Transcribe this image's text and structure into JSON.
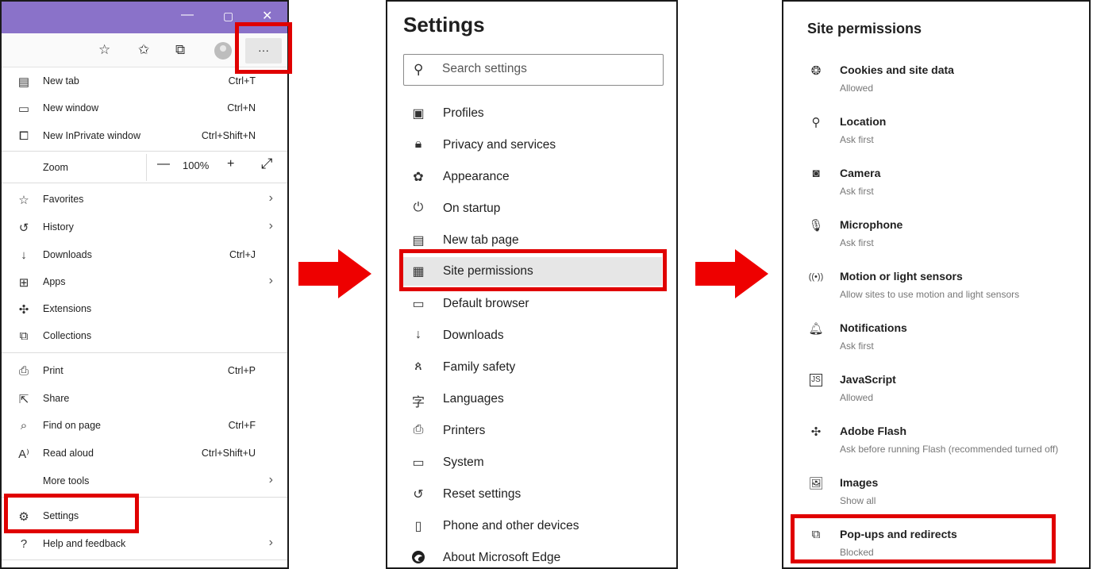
{
  "window": {
    "minimize": "—",
    "maximize": "▢",
    "close": "✕"
  },
  "toolbar": {
    "more_label": "···"
  },
  "menu": {
    "items_top": [
      {
        "label": "New tab",
        "shortcut": "Ctrl+T",
        "icon": "new-tab-icon"
      },
      {
        "label": "New window",
        "shortcut": "Ctrl+N",
        "icon": "window-icon"
      },
      {
        "label": "New InPrivate window",
        "shortcut": "Ctrl+Shift+N",
        "icon": "inprivate-icon"
      }
    ],
    "zoom": {
      "label": "Zoom",
      "minus": "—",
      "value": "100%",
      "plus": "+",
      "expand": "⤢"
    },
    "items_mid": [
      {
        "label": "Favorites",
        "icon": "favorites-icon"
      },
      {
        "label": "History",
        "icon": "history-icon"
      },
      {
        "label": "Downloads",
        "shortcut": "Ctrl+J",
        "icon": "download-icon"
      },
      {
        "label": "Apps",
        "icon": "apps-icon"
      },
      {
        "label": "Extensions",
        "icon": "extensions-icon"
      },
      {
        "label": "Collections",
        "icon": "collections-icon"
      }
    ],
    "items_bottom": [
      {
        "label": "Print",
        "shortcut": "Ctrl+P",
        "icon": "print-icon"
      },
      {
        "label": "Share",
        "icon": "share-icon"
      },
      {
        "label": "Find on page",
        "shortcut": "Ctrl+F",
        "icon": "find-icon"
      },
      {
        "label": "Read aloud",
        "shortcut": "Ctrl+Shift+U",
        "icon": "read-aloud-icon"
      },
      {
        "label": "More tools"
      },
      {
        "label": "Settings",
        "icon": "gear-icon"
      },
      {
        "label": "Help and feedback",
        "icon": "help-icon"
      }
    ]
  },
  "settings": {
    "title": "Settings",
    "search_placeholder": "Search settings",
    "items": [
      {
        "label": "Profiles",
        "icon": "profile-icon"
      },
      {
        "label": "Privacy and services",
        "icon": "lock-icon"
      },
      {
        "label": "Appearance",
        "icon": "palette-icon"
      },
      {
        "label": "On startup",
        "icon": "power-icon"
      },
      {
        "label": "New tab page",
        "icon": "new-tab-icon"
      },
      {
        "label": "Site permissions",
        "icon": "site-permissions-icon"
      },
      {
        "label": "Default browser",
        "icon": "browser-icon"
      },
      {
        "label": "Downloads",
        "icon": "download-icon"
      },
      {
        "label": "Family safety",
        "icon": "family-icon"
      },
      {
        "label": "Languages",
        "icon": "language-icon"
      },
      {
        "label": "Printers",
        "icon": "printer-icon"
      },
      {
        "label": "System",
        "icon": "system-icon"
      },
      {
        "label": "Reset settings",
        "icon": "reset-icon"
      },
      {
        "label": "Phone and other devices",
        "icon": "phone-icon"
      },
      {
        "label": "About Microsoft Edge",
        "icon": "edge-logo-icon"
      }
    ]
  },
  "permissions": {
    "title": "Site permissions",
    "items": [
      {
        "name": "Cookies and site data",
        "status": "Allowed",
        "icon": "cookie-icon"
      },
      {
        "name": "Location",
        "status": "Ask first",
        "icon": "location-icon"
      },
      {
        "name": "Camera",
        "status": "Ask first",
        "icon": "camera-icon"
      },
      {
        "name": "Microphone",
        "status": "Ask first",
        "icon": "microphone-icon"
      },
      {
        "name": "Motion or light sensors",
        "status": "Allow sites to use motion and light sensors",
        "icon": "sensor-icon"
      },
      {
        "name": "Notifications",
        "status": "Ask first",
        "icon": "bell-icon"
      },
      {
        "name": "JavaScript",
        "status": "Allowed",
        "icon": "javascript-icon"
      },
      {
        "name": "Adobe Flash",
        "status": "Ask before running Flash (recommended turned off)",
        "icon": "puzzle-icon"
      },
      {
        "name": "Images",
        "status": "Show all",
        "icon": "image-icon"
      },
      {
        "name": "Pop-ups and redirects",
        "status": "Blocked",
        "icon": "popup-icon"
      }
    ]
  },
  "accent_colors": {
    "title_bar": "#8a72c9",
    "highlight": "#e00000",
    "arrow": "#ee0000"
  }
}
